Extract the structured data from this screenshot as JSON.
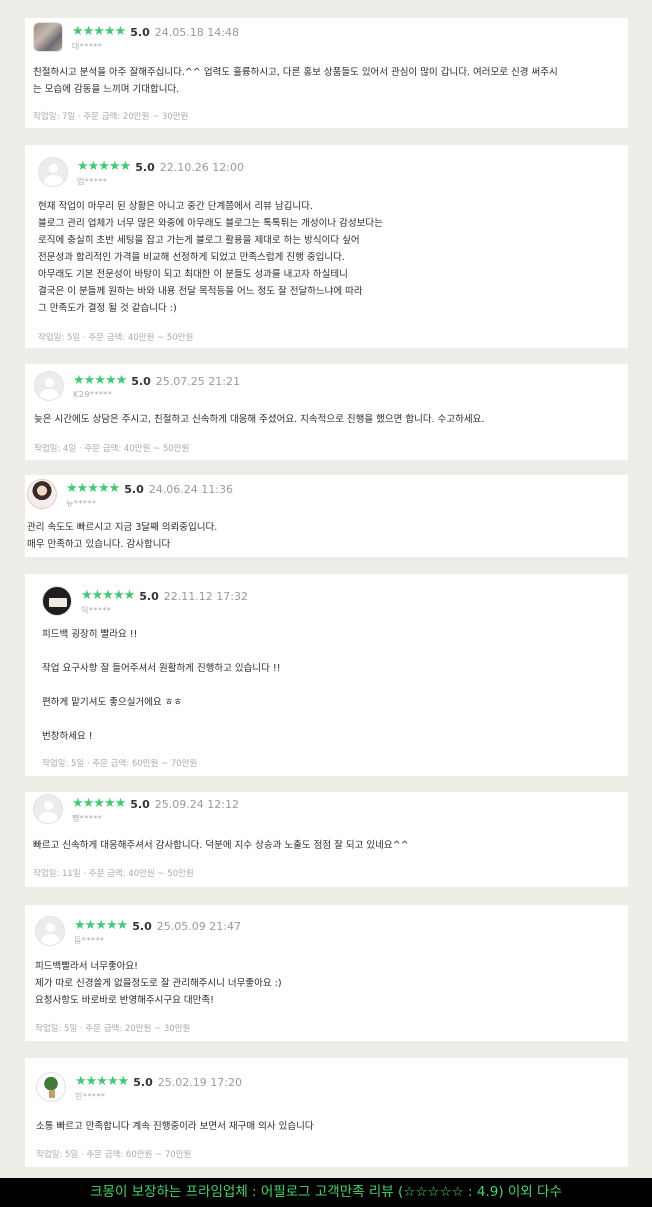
{
  "reviews": [
    {
      "stars": "★★★★★",
      "score": "5.0",
      "date": "24.05.18 14:48",
      "user": "대*****",
      "text": "친절하시고 분석을 아주 잘해주십니다.^^ 업력도 훌륭하시고, 다른 홍보 상품들도 있어서 관심이 많이 갑니다. 여러모로 신경 써주시\n는 모습에 감동을 느끼며 기대합니다.",
      "footer": "작업일: 7일 · 주문 금액: 20만원 ~ 30만원"
    },
    {
      "stars": "★★★★★",
      "score": "5.0",
      "date": "22.10.26 12:00",
      "user": "업*****",
      "text": "현재 작업이 마무리 된 상황은 아니고 중간 단계쯤에서 리뷰 남깁니다.\n블로그 관리 업체가 너무 많은 와중에 아무래도 블로그는 톡톡튀는 개성이나 감성보다는\n로직에 충실히 초반 세팅을 잡고 가는게 블로그 활용을 제대로 하는 방식이다 싶어\n전문성과 합리적인 가격을 비교해 선정하게 되었고 만족스럽게 진행 중입니다.\n아무래도 기본 전문성이 바탕이 되고 최대한 이 분들도 성과를 내고자 하실테니\n결국은 이 분들께 원하는 바와 내용 전달 목적등을 어느 정도 잘 전달하느냐에 따라\n그 만족도가 결정 될 것 같습니다 :)",
      "footer": "작업일: 5일 · 주문 금액: 40만원 ~ 50만원"
    },
    {
      "stars": "★★★★★",
      "score": "5.0",
      "date": "25.07.25 21:21",
      "user": "K29*****",
      "text": "늦은 시간에도 상담은 주시고, 친절하고 신속하게 대응해 주셨어요. 지속적으로 진행을 했으면 합니다. 수고하세요.",
      "footer": "작업일: 4일 · 주문 금액: 40만원 ~ 50만원"
    },
    {
      "stars": "★★★★★",
      "score": "5.0",
      "date": "24.06.24 11:36",
      "user": "뉴*****",
      "text": "관리 속도도 빠르시고 지금 3달째 의뢰중입니다.\n매우 만족하고 있습니다. 감사합니다",
      "footer": ""
    },
    {
      "stars": "★★★★★",
      "score": "5.0",
      "date": "22.11.12 17:32",
      "user": "익*****",
      "text": "피드백 굉장히 빨라요 !!\n\n작업 요구사항 잘 들어주셔서 원활하게 진행하고 있습니다 !!\n\n편하게 맡기셔도 좋으실거에요 ㅎㅎ\n\n번창하세요 !",
      "footer": "작업일: 5일 · 주문 금액: 60만원 ~ 70만원"
    },
    {
      "stars": "★★★★★",
      "score": "5.0",
      "date": "25.09.24 12:12",
      "user": "쨍*****",
      "text": "빠르고 신속하게 대응해주셔서 감사합니다.  덕분에 지수 상승과 노출도 점점 잘 되고 있네요^^",
      "footer": "작업일: 11일 · 주문 금액: 40만원 ~ 50만원"
    },
    {
      "stars": "★★★★★",
      "score": "5.0",
      "date": "25.05.09 21:47",
      "user": "듬*****",
      "text": "피드백빨라서 너무좋아요!\n제가 따로 신경쓸게 없을정도로 잘 관리해주시니 너무좋아요 :)\n요청사항도 바로바로 반영해주시구요 대만족!",
      "footer": "작업일: 5일 · 주문 금액: 20만원 ~ 30만원"
    },
    {
      "stars": "★★★★★",
      "score": "5.0",
      "date": "25.02.19 17:20",
      "user": "민*****",
      "text": "소통 빠르고 만족합니다 계속 진행중이라 보면서 재구매 의사 있습니다",
      "footer": "작업일: 5일 · 주문 금액: 60만원 ~ 70만원"
    }
  ],
  "banner": "크몽이 보장하는 프라임업체 : 어필로그 고객만족 리뷰 (☆☆☆☆☆ : 4.9) 이외 다수",
  "colors": {
    "star": "#3fcb73",
    "banner_text": "#3fd86b",
    "background": "#efede8"
  }
}
